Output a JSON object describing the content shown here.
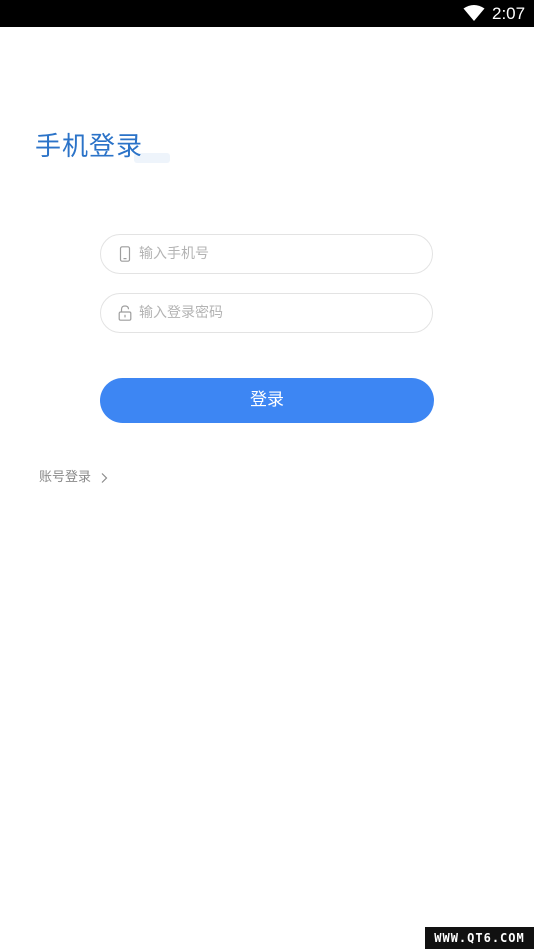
{
  "status_bar": {
    "time": "2:07",
    "wifi_icon": "wifi-icon"
  },
  "page": {
    "title": "手机登录"
  },
  "form": {
    "phone": {
      "placeholder": "输入手机号",
      "value": "",
      "icon": "phone-icon"
    },
    "password": {
      "placeholder": "输入登录密码",
      "value": "",
      "icon": "lock-icon"
    },
    "submit_label": "登录"
  },
  "links": {
    "account_login": "账号登录",
    "account_login_icon": "chevron-right-icon"
  },
  "watermark": "WWW.QT6.COM",
  "colors": {
    "title": "#2b73c8",
    "button": "#3d86f3",
    "field_border": "#e3e3e3",
    "placeholder": "#b3b3b3",
    "link": "#8a8a8a"
  }
}
